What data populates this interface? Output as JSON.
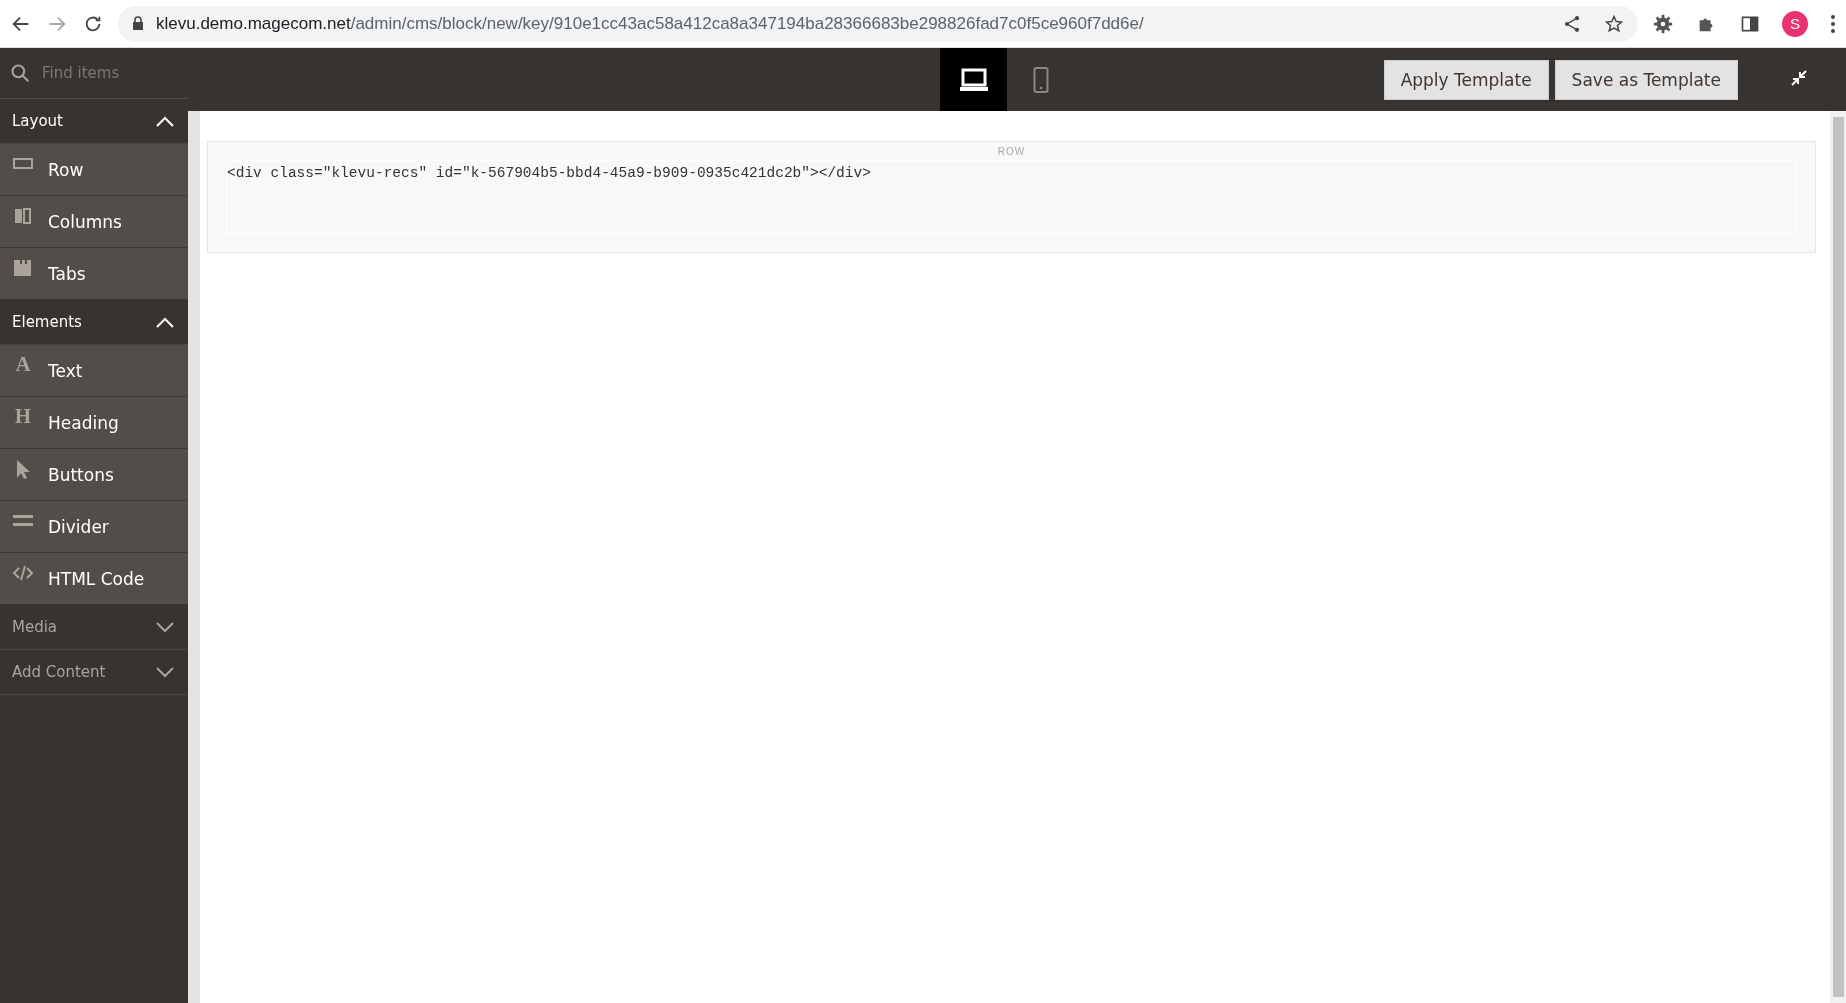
{
  "browser": {
    "url_host": "klevu.demo.magecom.net",
    "url_path": "/admin/cms/block/new/key/910e1cc43ac58a412ca8a347194ba28366683be298826fad7c0f5ce960f7dd6e/",
    "profile_initial": "S"
  },
  "sidebar": {
    "search": {
      "placeholder": "Find items"
    },
    "groups": [
      {
        "label": "Layout",
        "expanded": true,
        "items": [
          {
            "label": "Row"
          },
          {
            "label": "Columns"
          },
          {
            "label": "Tabs"
          }
        ]
      },
      {
        "label": "Elements",
        "expanded": true,
        "items": [
          {
            "label": "Text",
            "glyph": "A"
          },
          {
            "label": "Heading",
            "glyph": "H"
          },
          {
            "label": "Buttons"
          },
          {
            "label": "Divider"
          },
          {
            "label": "HTML Code"
          }
        ]
      },
      {
        "label": "Media",
        "expanded": false
      },
      {
        "label": "Add Content",
        "expanded": false
      }
    ]
  },
  "toolbar": {
    "viewports": [
      {
        "kind": "desktop",
        "selected": true
      },
      {
        "kind": "mobile",
        "selected": false
      }
    ],
    "buttons": [
      "Apply Template",
      "Save as Template"
    ]
  },
  "stage": {
    "row": {
      "label": "ROW",
      "html_code": "<div class=\"klevu-recs\" id=\"k-567904b5-bbd4-45a9-b909-0935c421dc2b\"></div>"
    }
  }
}
